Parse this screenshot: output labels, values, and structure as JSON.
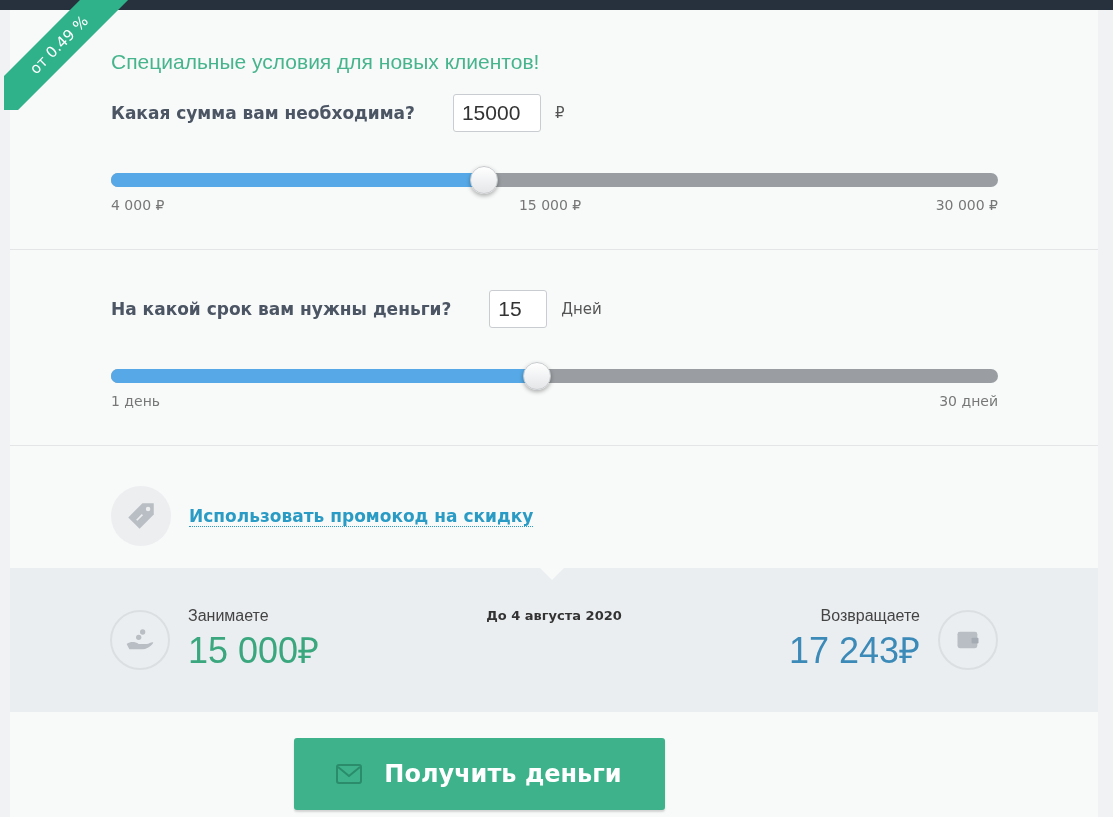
{
  "ribbon": {
    "text": "от 0.49 %"
  },
  "headline": "Специальные условия для новых клиентов!",
  "questions": [
    {
      "label": "Какая сумма вам необходима?",
      "value": "15000",
      "unit": "₽",
      "level": 0.42,
      "ticks": [
        "4 000 ₽",
        "15 000 ₽",
        "30 000 ₽"
      ]
    },
    {
      "label": "На какой срок вам нужны деньги?",
      "value": "15",
      "unit": "Дней",
      "level": 0.48,
      "ticks": [
        "1 день",
        "30 дней"
      ]
    }
  ],
  "promo_link": "Использовать промокод на скидку",
  "summary": {
    "borrow_label": "Занимаете",
    "borrow_amount": "15 000₽",
    "due_date": "До 4 августа 2020",
    "return_label": "Возвращаете",
    "return_amount": "17 243₽"
  },
  "submit_button": "Получить деньги"
}
